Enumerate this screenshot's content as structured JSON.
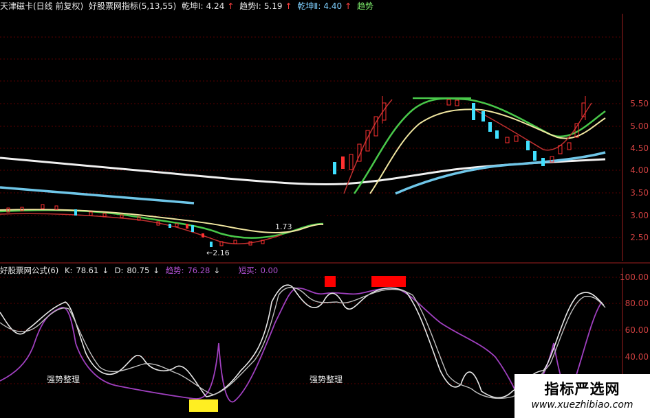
{
  "header": {
    "symbol": "天津磁卡(日线 前复权)",
    "indicator_name": "好股票网指标(5,13,55)",
    "qiankun1_label": "乾坤Ⅰ:",
    "qiankun1_value": "4.24",
    "qushi1_label": "趋势Ⅰ:",
    "qushi1_value": "5.19",
    "qiankun2_label": "乾坤Ⅱ:",
    "qiankun2_value": "4.40",
    "extra_label": "趋势"
  },
  "price_axis": {
    "ticks": [
      "5.50",
      "5.00",
      "4.50",
      "4.00",
      "3.50",
      "3.00",
      "2.50"
    ]
  },
  "price_annotations": {
    "low_marker": "←2.16",
    "peak_marker": "1.73"
  },
  "sub_header": {
    "formula": "好股票网公式(6)",
    "k_label": "K:",
    "k_value": "78.61",
    "d_label": "D:",
    "d_value": "80.75",
    "trend_label": "趋势:",
    "trend_value": "76.28",
    "short_buy_label": "短买:",
    "short_buy_value": "0.00"
  },
  "sub_axis": {
    "ticks": [
      "100.00",
      "80.00",
      "60.00",
      "40.00"
    ]
  },
  "sub_annotations": {
    "zone_left": "强势整理",
    "zone_right": "强势整理"
  },
  "watermark": {
    "title": "指标严选网",
    "url": "www.xuezhibiao.com"
  },
  "colors": {
    "background": "#000000",
    "up_candle": "#ff3030",
    "down_candle": "#40e0ff",
    "ma_white": "#f0f0f0",
    "ma_cyan": "#6fc6e8",
    "ma_green": "#49c84a",
    "ma_yellow": "#f0e6a0",
    "kdj_purple": "#a040c0",
    "signal_red": "#ff0000",
    "signal_yellow": "#ffee22"
  }
}
